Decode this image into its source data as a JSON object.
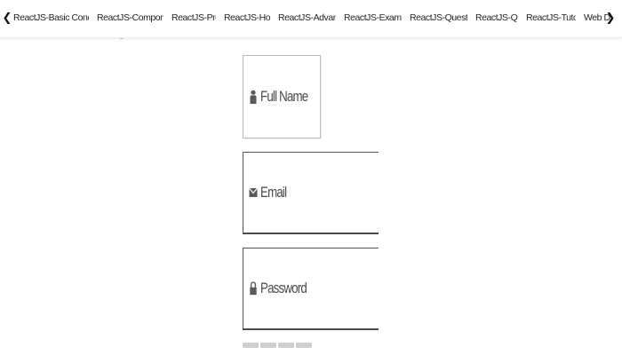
{
  "tabbar": {
    "tabs": [
      {
        "label": "ReactJS-Basic Concepts"
      },
      {
        "label": "ReactJS-Components"
      },
      {
        "label": "ReactJS-Props"
      },
      {
        "label": "ReactJS-Hooks"
      },
      {
        "label": "ReactJS-Advanced"
      },
      {
        "label": "ReactJS-Examples"
      },
      {
        "label": "ReactJS-Questions"
      },
      {
        "label": "ReactJS-Quiz"
      },
      {
        "label": "ReactJS-Tutorial"
      },
      {
        "label": "Web Dev"
      }
    ],
    "left_icon": "chevron-left-icon",
    "right_icon": "chevron-right-icon"
  },
  "form": {
    "full_name": {
      "placeholder": "Full Name",
      "icon": "user-icon"
    },
    "email": {
      "placeholder": "Email",
      "icon": "envelope-icon"
    },
    "password": {
      "placeholder": "Password",
      "icon": "lock-icon"
    }
  },
  "colors": {
    "icon": "#5a5a5a",
    "field_border_dark": "#4a4a4a",
    "placeholder_text": "#4a4a4a",
    "loader": "#cfcfcf"
  }
}
